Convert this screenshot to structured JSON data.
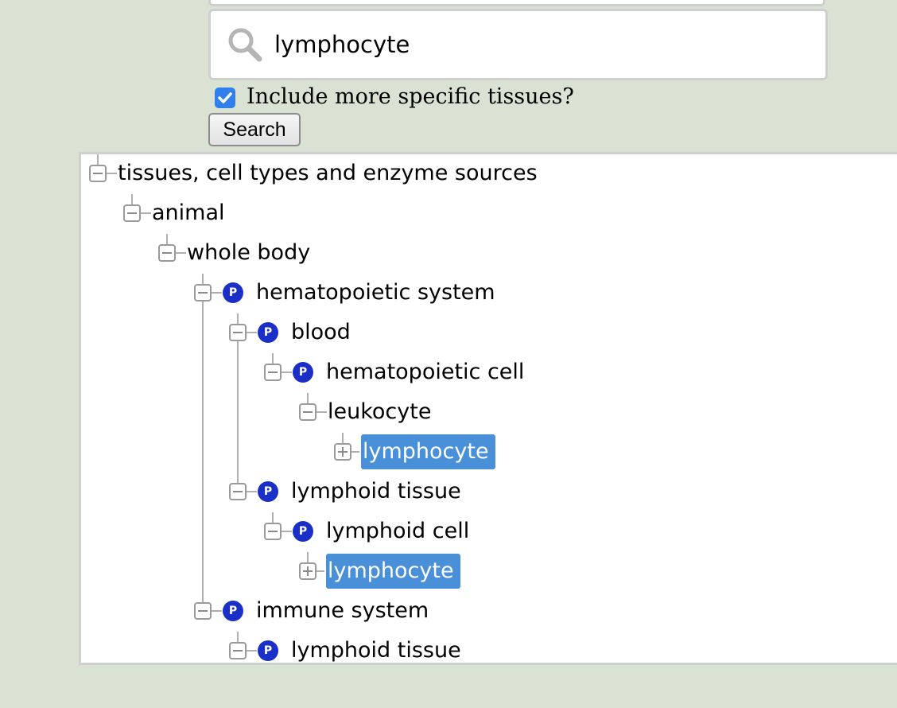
{
  "search": {
    "value": "lymphocyte",
    "button_label": "Search",
    "include_specific_label": "Include more specific tissues?",
    "include_specific_checked": true
  },
  "tree": {
    "badge_letter": "P",
    "nodes": [
      {
        "label": "tissues, cell types and enzyme sources",
        "expanded": true,
        "has_badge": false,
        "selected": false
      },
      {
        "label": "animal",
        "expanded": true,
        "has_badge": false,
        "selected": false
      },
      {
        "label": "whole body",
        "expanded": true,
        "has_badge": false,
        "selected": false
      },
      {
        "label": "hematopoietic system",
        "expanded": true,
        "has_badge": true,
        "selected": false
      },
      {
        "label": "blood",
        "expanded": true,
        "has_badge": true,
        "selected": false
      },
      {
        "label": "hematopoietic cell",
        "expanded": true,
        "has_badge": true,
        "selected": false
      },
      {
        "label": "leukocyte",
        "expanded": true,
        "has_badge": false,
        "selected": false
      },
      {
        "label": "lymphocyte",
        "expanded": false,
        "has_badge": false,
        "selected": true
      },
      {
        "label": "lymphoid tissue",
        "expanded": true,
        "has_badge": true,
        "selected": false
      },
      {
        "label": "lymphoid cell",
        "expanded": true,
        "has_badge": true,
        "selected": false
      },
      {
        "label": "lymphocyte",
        "expanded": false,
        "has_badge": false,
        "selected": true
      },
      {
        "label": "immune system",
        "expanded": true,
        "has_badge": true,
        "selected": false
      },
      {
        "label": "lymphoid tissue",
        "expanded": true,
        "has_badge": true,
        "selected": false
      }
    ]
  },
  "colors": {
    "background": "#dae2d4",
    "selection": "#4a90d9",
    "badge": "#1a2fc7"
  }
}
